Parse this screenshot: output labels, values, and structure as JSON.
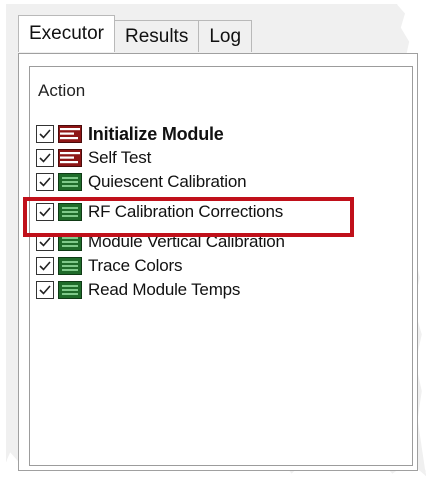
{
  "tabs": [
    {
      "label": "Executor",
      "active": true
    },
    {
      "label": "Results",
      "active": false
    },
    {
      "label": "Log",
      "active": false
    }
  ],
  "list": {
    "column_header": "Action",
    "items": [
      {
        "label": "Initialize Module",
        "checked": true,
        "bold": true,
        "icon": "red-sequence-icon"
      },
      {
        "label": "Self Test",
        "checked": true,
        "bold": false,
        "icon": "red-sequence-icon"
      },
      {
        "label": "Quiescent Calibration",
        "checked": true,
        "bold": false,
        "icon": "green-table-icon"
      },
      {
        "label": "RF Calibration Corrections",
        "checked": true,
        "bold": false,
        "icon": "green-table-icon",
        "highlighted": true
      },
      {
        "label": "Module Vertical Calibration",
        "checked": true,
        "bold": false,
        "icon": "green-table-icon"
      },
      {
        "label": "Trace Colors",
        "checked": true,
        "bold": false,
        "icon": "green-table-icon"
      },
      {
        "label": "Read Module Temps",
        "checked": true,
        "bold": false,
        "icon": "green-table-icon"
      }
    ]
  },
  "colors": {
    "highlight_border": "#c0101a",
    "red_icon": "#9e1a1a",
    "green_icon": "#1f6b2a"
  }
}
